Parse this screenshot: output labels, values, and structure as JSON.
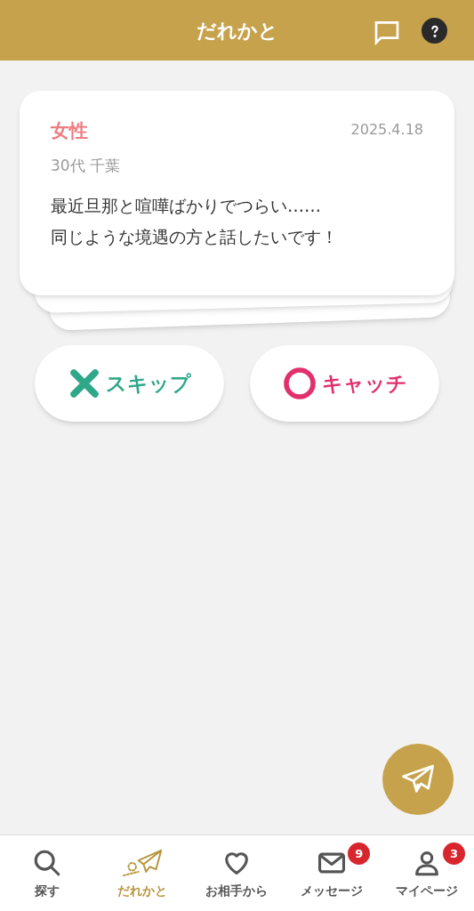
{
  "header": {
    "title": "だれかと"
  },
  "card": {
    "gender": "女性",
    "date": "2025.4.18",
    "profile": "30代 千葉",
    "message": [
      "最近旦那と喧嘩ばかりでつらい……",
      "同じような境遇の方と話したいです！"
    ]
  },
  "actions": [
    {
      "kind": "skip",
      "label": "スキップ"
    },
    {
      "kind": "catch",
      "label": "キャッチ"
    }
  ],
  "nav": [
    {
      "kind": "search",
      "label": "探す",
      "selected": false
    },
    {
      "kind": "plane",
      "label": "だれかと",
      "selected": true
    },
    {
      "kind": "heart",
      "label": "お相手から",
      "selected": false
    },
    {
      "kind": "mail",
      "label": "メッセージ",
      "selected": false,
      "badge": "9"
    },
    {
      "kind": "user",
      "label": "マイページ",
      "selected": false,
      "badge": "3"
    }
  ]
}
